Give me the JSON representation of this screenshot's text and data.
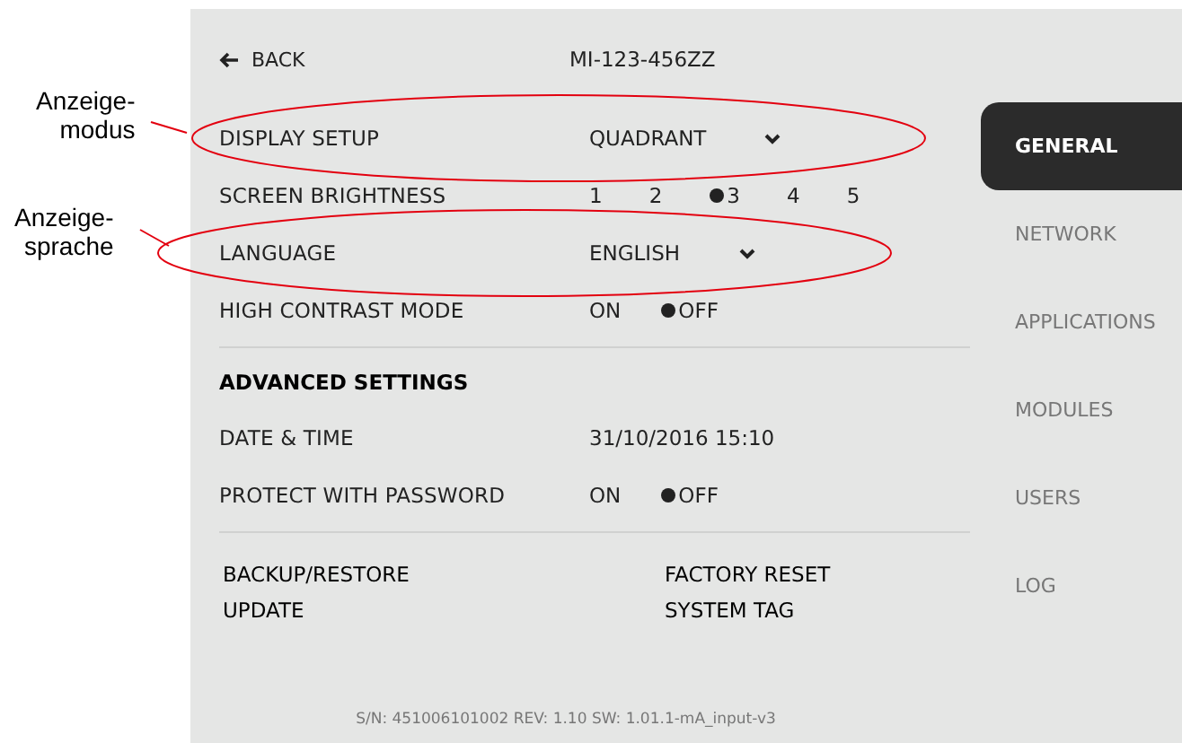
{
  "header": {
    "back": "BACK",
    "device_id": "MI-123-456ZZ"
  },
  "settings": [
    {
      "kind": "dropdown",
      "label": "DISPLAY SETUP",
      "value": "QUADRANT"
    },
    {
      "kind": "choice",
      "label": "SCREEN BRIGHTNESS",
      "options": [
        {
          "label": "1",
          "selected": false
        },
        {
          "label": "2",
          "selected": false
        },
        {
          "label": "3",
          "selected": true
        },
        {
          "label": "4",
          "selected": false
        },
        {
          "label": "5",
          "selected": false
        }
      ]
    },
    {
      "kind": "dropdown",
      "label": "LANGUAGE",
      "value": "ENGLISH"
    },
    {
      "kind": "choice",
      "label": "HIGH CONTRAST MODE",
      "options": [
        {
          "label": "ON",
          "selected": false
        },
        {
          "label": "OFF",
          "selected": true
        }
      ]
    }
  ],
  "advanced": {
    "title": "ADVANCED SETTINGS",
    "settings": [
      {
        "kind": "text",
        "label": "DATE & TIME",
        "value": "31/10/2016 15:10"
      },
      {
        "kind": "choice",
        "label": "PROTECT WITH PASSWORD",
        "options": [
          {
            "label": "ON",
            "selected": false
          },
          {
            "label": "OFF",
            "selected": true
          }
        ]
      }
    ]
  },
  "actions": [
    "BACKUP/RESTORE",
    "FACTORY RESET",
    "UPDATE",
    "SYSTEM TAG"
  ],
  "footer": "S/N: 451006101002  REV: 1.10  SW: 1.01.1-mA_input-v3",
  "sidebar": {
    "items": [
      {
        "label": "GENERAL",
        "selected": true
      },
      {
        "label": "NETWORK",
        "selected": false
      },
      {
        "label": "APPLICATIONS",
        "selected": false
      },
      {
        "label": "MODULES",
        "selected": false
      },
      {
        "label": "USERS",
        "selected": false
      },
      {
        "label": "LOG",
        "selected": false
      }
    ]
  },
  "annotations": [
    {
      "text": "Anzeige-\nmodus"
    },
    {
      "text": "Anzeige-\nsprache"
    }
  ]
}
